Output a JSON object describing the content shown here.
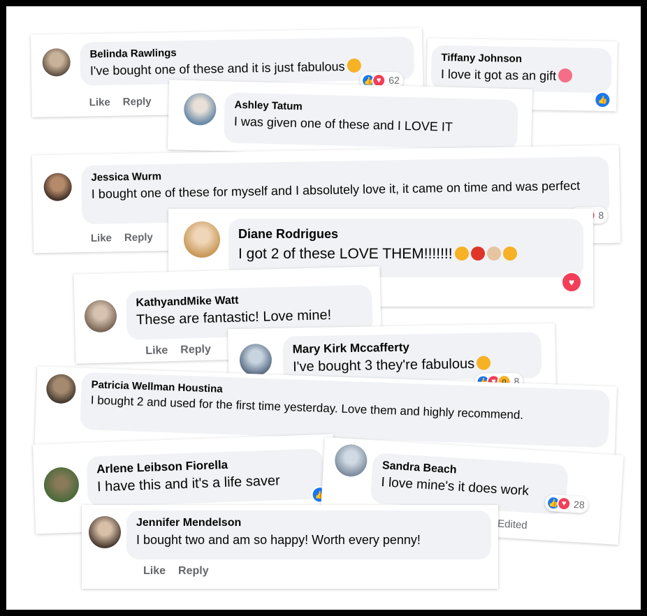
{
  "actions": {
    "like": "Like",
    "reply": "Reply"
  },
  "colors": {
    "like": "#1877f2",
    "love": "#f33e58",
    "wow": "#f7b125",
    "bubble": "#f0f2f5",
    "action": "#65676b"
  },
  "comments": [
    {
      "name": "Belinda Rawlings",
      "text": "I've bought one of these and it is just fabulous",
      "reaction_count": "62"
    },
    {
      "name": "Tiffany Johnson",
      "text": "I love it got as an gift"
    },
    {
      "name": "Ashley Tatum",
      "text": "I was given one of these and I LOVE IT"
    },
    {
      "name": "Jessica Wurm",
      "text": "I bought one of these for myself and I absolutely love it, it came on time and was perfect",
      "reaction_count": "8"
    },
    {
      "name": "Diane Rodrigues",
      "text": "I got 2 of these LOVE THEM!!!!!!!"
    },
    {
      "name": "KathyandMike Watt",
      "text": "These are fantastic! Love mine!"
    },
    {
      "name": "Mary Kirk Mccafferty",
      "text": "I've bought 3 they're fabulous",
      "reaction_count": "8"
    },
    {
      "name": "Patricia Wellman Houstina",
      "text": "I bought 2 and used for the first time yesterday. Love them and highly recommend."
    },
    {
      "name": "Arlene Leibson Fiorella",
      "text": "I have this and it's a life saver"
    },
    {
      "name": "Sandra Beach",
      "text": "I love mine's it does work",
      "reaction_count": "28",
      "edited": "Edited"
    },
    {
      "name": "Jennifer Mendelson",
      "text": "I bought two and am so happy! Worth every penny!"
    }
  ]
}
